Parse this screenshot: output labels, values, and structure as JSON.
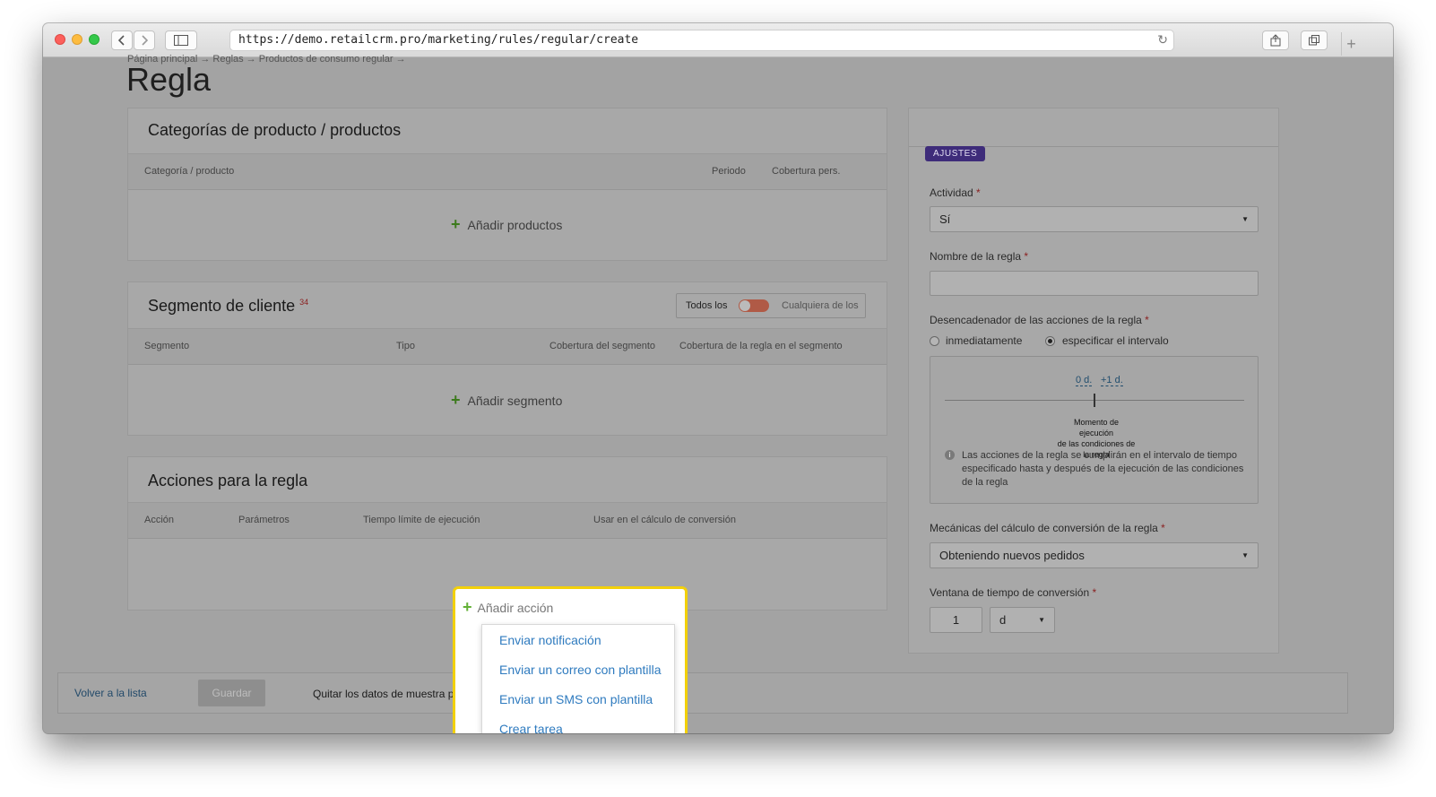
{
  "browser": {
    "url": "https://demo.retailcrm.pro/marketing/rules/regular/create"
  },
  "page": {
    "breadcrumb": "Página principal → Reglas → Productos de consumo regular →",
    "title": "Regla"
  },
  "products_panel": {
    "title": "Categorías de producto / productos",
    "columns": [
      "Categoría / producto",
      "Periodo",
      "Cobertura pers."
    ],
    "add_label": "Añadir productos"
  },
  "segment_panel": {
    "title": "Segmento de cliente",
    "count": "34",
    "toggle_left": "Todos los",
    "toggle_right": "Cualquiera de los",
    "columns": [
      "Segmento",
      "Tipo",
      "Cobertura del segmento",
      "Cobertura de la regla en el segmento"
    ],
    "add_label": "Añadir segmento"
  },
  "actions_panel": {
    "title": "Acciones para la regla",
    "columns": [
      "Acción",
      "Parámetros",
      "Tiempo límite de ejecución",
      "Usar en el cálculo de conversión"
    ]
  },
  "settings": {
    "badge": "AJUSTES",
    "activity_label": "Actividad",
    "activity_value": "Sí",
    "rule_name_label": "Nombre de la regla",
    "rule_name_value": "",
    "trigger_label": "Desencadenador de las acciones de la regla",
    "trigger_options": [
      "inmediatamente",
      "especificar el intervalo"
    ],
    "trigger_selected": "especificar el intervalo",
    "interval_before": "0 d.",
    "interval_after": "+1 d.",
    "moment_lines": [
      "Momento de",
      "ejecución",
      "de las condiciones de",
      "la regla"
    ],
    "info_text": "Las acciones de la regla se cumplirán en el intervalo de tiempo especificado hasta y después de la ejecución de las condiciones de la regla",
    "conversion_label": "Mecánicas del cálculo de conversión de la regla",
    "conversion_value": "Obteniendo nuevos pedidos",
    "window_label": "Ventana de tiempo de conversión",
    "window_value": "1",
    "window_unit": "d"
  },
  "footer": {
    "back_label": "Volver a la lista",
    "save_label": "Guardar",
    "text": "Quitar los datos de muestra para tra"
  },
  "add_action": {
    "label": "Añadir acción",
    "menu": [
      "Enviar notificación",
      "Enviar un correo con plantilla",
      "Enviar un SMS con plantilla",
      "Crear tarea"
    ]
  }
}
